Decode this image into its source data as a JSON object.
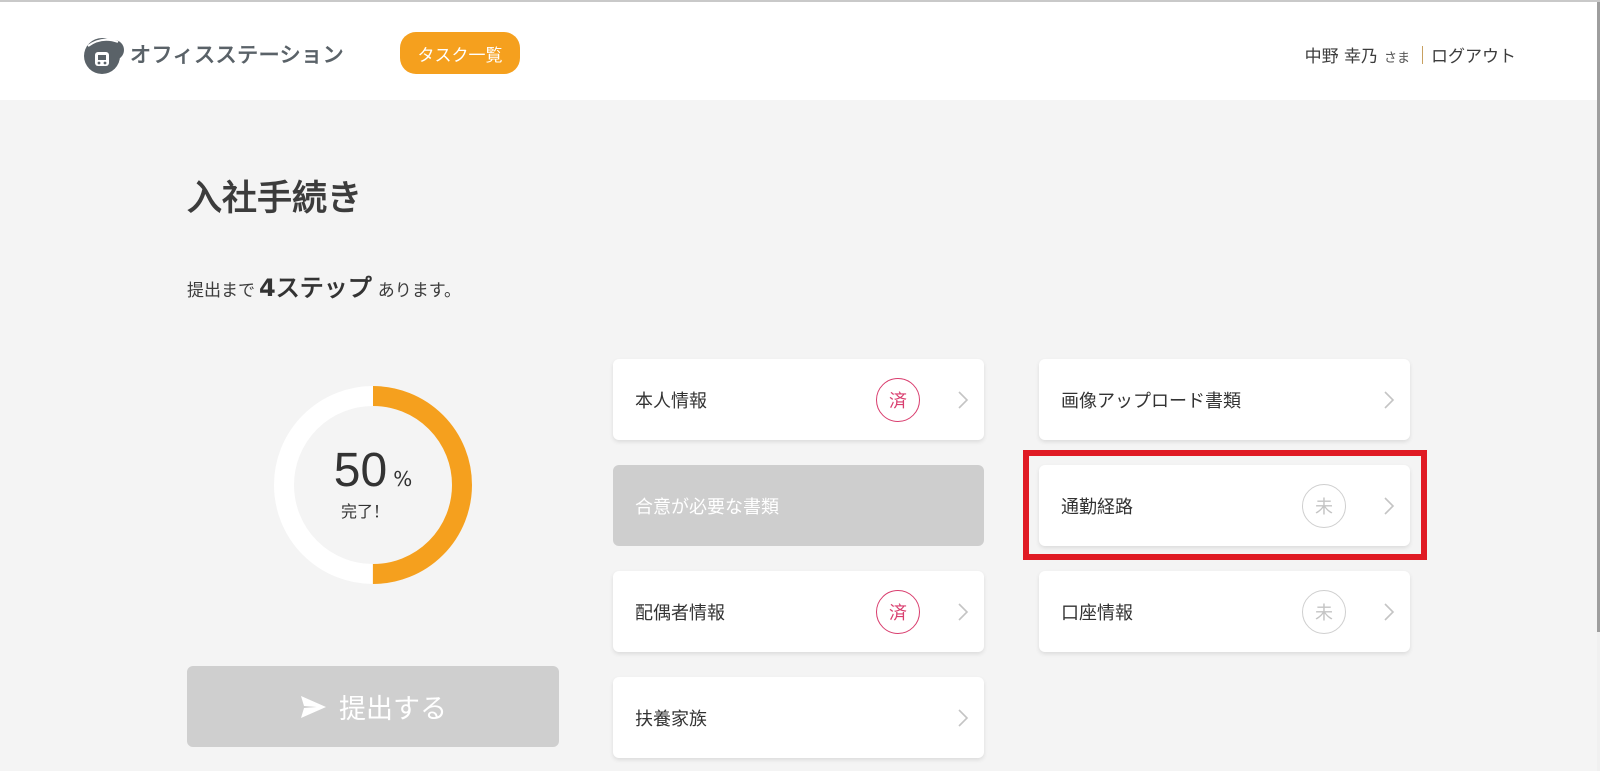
{
  "header": {
    "logo_text": "オフィスステーション",
    "task_button_label": "タスク一覧",
    "user_name": "中野 幸乃",
    "user_suffix": "さま",
    "logout_label": "ログアウト"
  },
  "main": {
    "title": "入社手続き",
    "steps_prefix": "提出まで",
    "steps_count": "4ステップ",
    "steps_suffix": "あります。",
    "progress": {
      "percent": 50,
      "percent_text": "50",
      "percent_sign": "%",
      "done_label": "完了！"
    },
    "submit_label": "提出する"
  },
  "cards": [
    {
      "label": "本人情報",
      "badge": "済",
      "status": "done"
    },
    {
      "label": "画像アップロード書類",
      "badge": "",
      "status": "none"
    },
    {
      "label": "合意が必要な書類",
      "badge": "",
      "status": "disabled"
    },
    {
      "label": "通勤経路",
      "badge": "未",
      "status": "pending"
    },
    {
      "label": "配偶者情報",
      "badge": "済",
      "status": "done"
    },
    {
      "label": "口座情報",
      "badge": "未",
      "status": "pending"
    },
    {
      "label": "扶養家族",
      "badge": "",
      "status": "none"
    }
  ],
  "colors": {
    "accent": "#f5a01e",
    "done_badge": "#d93d6e",
    "pending_badge": "#c4c4c4",
    "disabled_card": "#cecece",
    "highlight": "#e01b24"
  }
}
